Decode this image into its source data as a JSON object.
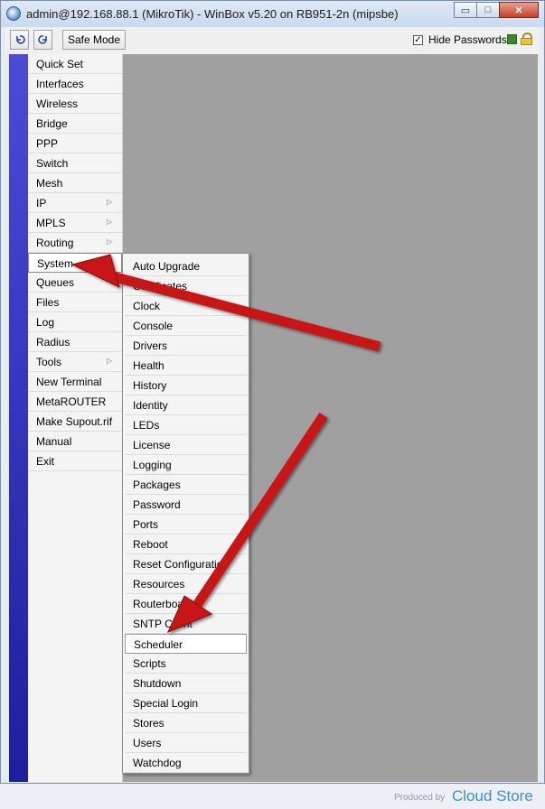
{
  "window": {
    "title": "admin@192.168.88.1 (MikroTik) - WinBox v5.20 on RB951-2n (mipsbe)",
    "controls": {
      "minimize": "▭",
      "maximize": "□",
      "close": "✕"
    }
  },
  "toolbar": {
    "undo_icon": "undo-icon",
    "redo_icon": "redo-icon",
    "safe_mode_label": "Safe Mode",
    "hide_passwords_label": "Hide Passwords",
    "hide_passwords_checked": true
  },
  "main_menu": [
    {
      "label": "Quick Set",
      "submenu": false
    },
    {
      "label": "Interfaces",
      "submenu": false
    },
    {
      "label": "Wireless",
      "submenu": false
    },
    {
      "label": "Bridge",
      "submenu": false
    },
    {
      "label": "PPP",
      "submenu": false
    },
    {
      "label": "Switch",
      "submenu": false
    },
    {
      "label": "Mesh",
      "submenu": false
    },
    {
      "label": "IP",
      "submenu": true
    },
    {
      "label": "MPLS",
      "submenu": true
    },
    {
      "label": "Routing",
      "submenu": true
    },
    {
      "label": "System",
      "submenu": true
    },
    {
      "label": "Queues",
      "submenu": false
    },
    {
      "label": "Files",
      "submenu": false
    },
    {
      "label": "Log",
      "submenu": false
    },
    {
      "label": "Radius",
      "submenu": false
    },
    {
      "label": "Tools",
      "submenu": true
    },
    {
      "label": "New Terminal",
      "submenu": false
    },
    {
      "label": "MetaROUTER",
      "submenu": false
    },
    {
      "label": "Make Supout.rif",
      "submenu": false
    },
    {
      "label": "Manual",
      "submenu": false
    },
    {
      "label": "Exit",
      "submenu": false
    }
  ],
  "system_submenu": [
    "Auto Upgrade",
    "Certificates",
    "Clock",
    "Console",
    "Drivers",
    "Health",
    "History",
    "Identity",
    "LEDs",
    "License",
    "Logging",
    "Packages",
    "Password",
    "Ports",
    "Reboot",
    "Reset Configuration",
    "Resources",
    "Routerboard",
    "SNTP Client",
    "Scheduler",
    "Scripts",
    "Shutdown",
    "Special Login",
    "Stores",
    "Users",
    "Watchdog"
  ],
  "active_menu_item": "System",
  "highlighted_submenu_item": "Scheduler",
  "footer": {
    "produced_by": "Produced by",
    "brand": "Cloud Store"
  },
  "colors": {
    "brand_bar": "#3434c8",
    "arrow": "#c81414",
    "workspace": "#a0a0a0",
    "brand_text": "#3b92c9"
  }
}
